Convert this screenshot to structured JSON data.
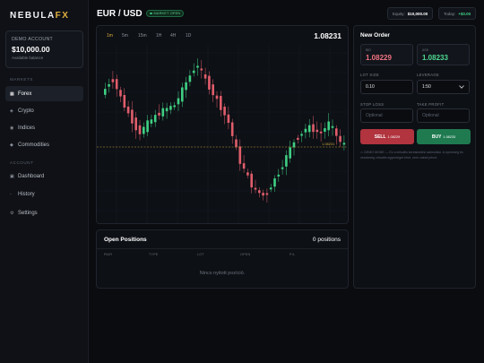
{
  "brand": {
    "name_main": "NEBULA",
    "name_accent": "FX"
  },
  "account": {
    "label": "DEMO ACCOUNT",
    "balance": "$10,000.00",
    "sub": "Available balance"
  },
  "sidebar": {
    "markets_label": "MARKETS",
    "account_label": "ACCOUNT",
    "markets": [
      {
        "label": "Forex",
        "icon": "▦"
      },
      {
        "label": "Crypto",
        "icon": "◈"
      },
      {
        "label": "Indices",
        "icon": "◉"
      },
      {
        "label": "Commodities",
        "icon": "◆"
      }
    ],
    "account_items": [
      {
        "label": "Dashboard",
        "icon": "▣"
      },
      {
        "label": "History",
        "icon": "◦"
      },
      {
        "label": "Settings",
        "icon": "⚙"
      }
    ]
  },
  "header": {
    "pair": "EUR / USD",
    "status": "MARKET OPEN",
    "equity_label": "Equity",
    "equity_value": "$10,000.00",
    "today_label": "Today",
    "today_value": "+$0.00"
  },
  "chart": {
    "timeframes": [
      "1m",
      "5m",
      "15m",
      "1H",
      "4H",
      "1D"
    ],
    "active_timeframe": "1m",
    "current_price": "1.08231",
    "current_price_marker": "1.08231",
    "up_color": "#3fcf83",
    "down_color": "#e05d6b"
  },
  "positions": {
    "title": "Open Positions",
    "count": "0 positions",
    "columns": [
      "PAIR",
      "TYPE",
      "LOT",
      "OPEN",
      "P/L"
    ],
    "empty": "Nincs nyitott pozíció."
  },
  "order": {
    "title": "New Order",
    "bid_label": "BID",
    "bid_value": "1.08229",
    "ask_label": "ASK",
    "ask_value": "1.08233",
    "lot_label": "LOT SIZE",
    "lot_value": "0.10",
    "leverage_label": "LEVERAGE",
    "leverage_value": "1:50",
    "sl_label": "STOP LOSS",
    "sl_placeholder": "Optional",
    "tp_label": "TAKE PROFIT",
    "tp_placeholder": "Optional",
    "sell_label": "SELL",
    "sell_price": "1.08229",
    "buy_label": "BUY",
    "buy_price": "1.08233",
    "demo_note": "⚠ DEMO MODE — Ez a virtuális kereskedési szimulátor. A nyereség és veszteség virtuális egyenleget érint, nem valódi pénzt."
  }
}
